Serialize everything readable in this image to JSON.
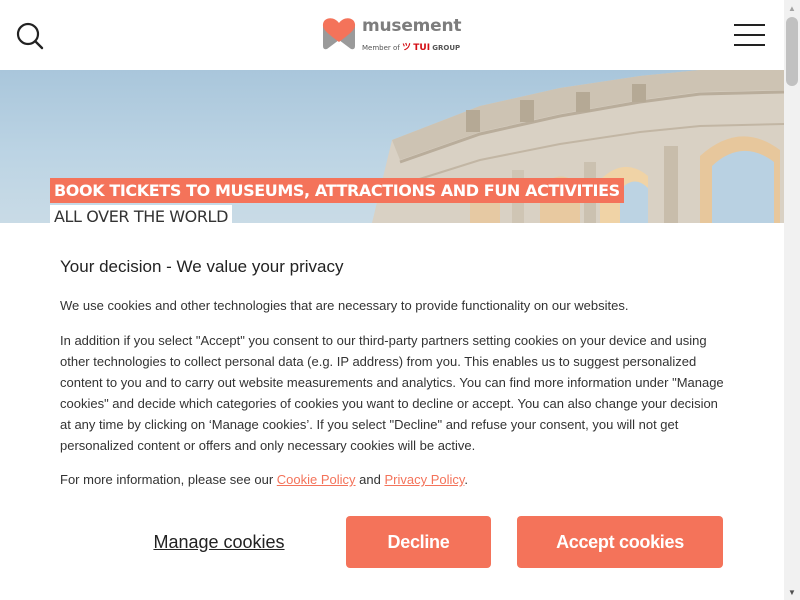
{
  "header": {
    "logo_name": "musement",
    "logo_member_prefix": "Member of",
    "logo_tui": "TUI",
    "logo_group": "GROUP",
    "search_icon": "search-icon",
    "menu_icon": "hamburger-menu-icon"
  },
  "hero": {
    "headline_line1": "BOOK TICKETS TO MUSEUMS, ATTRACTIONS AND FUN ACTIVITIES",
    "headline_line2": "ALL OVER THE WORLD"
  },
  "cookie_dialog": {
    "title": "Your decision - We value your privacy",
    "paragraph1": "We use cookies and other technologies that are necessary to provide functionality on our websites.",
    "paragraph2": "In addition if you select \"Accept\" you consent to our third-party partners setting cookies on your device and using other technologies to collect personal data (e.g. IP address) from you. This enables us to suggest personalized content to you and to carry out website measurements and analytics. You can find more information under \"Manage cookies\" and decide which categories of cookies you want to decline or accept. You can also change your decision at any time by clicking on ‘Manage cookies’. If you select \"Decline\" and refuse your consent, you will not get personalized content or offers and only necessary cookies will be active.",
    "paragraph3_prefix": "For more information, please see our ",
    "cookie_policy_link": "Cookie Policy",
    "paragraph3_and": " and ",
    "privacy_policy_link": "Privacy Policy",
    "paragraph3_suffix": ".",
    "manage_label": "Manage cookies",
    "decline_label": "Decline",
    "accept_label": "Accept cookies"
  },
  "colors": {
    "brand": "#f4735a",
    "text": "#333333",
    "tui_red": "#d40e14"
  }
}
